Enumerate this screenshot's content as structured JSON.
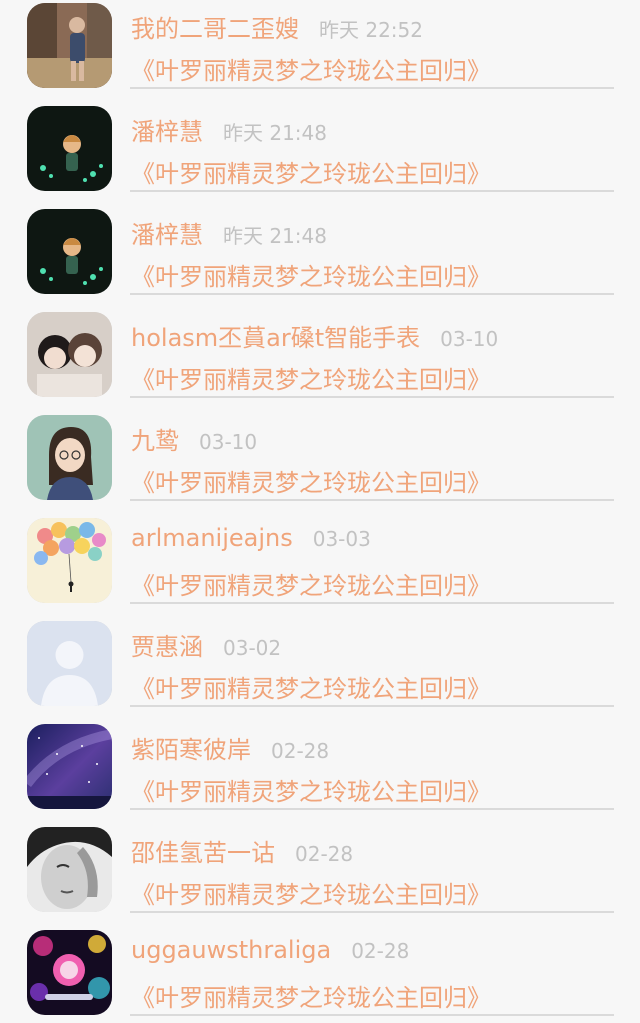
{
  "comments": [
    {
      "name": "我的二哥二歪嫂",
      "time": "昨天 22:52",
      "title": "《叶罗丽精灵梦之玲珑公主回归》",
      "avatar": "avatar-photo-girl-park"
    },
    {
      "name": "潘梓慧",
      "time": "昨天 21:48",
      "title": "《叶罗丽精灵梦之玲珑公主回归》",
      "avatar": "avatar-moon-boy"
    },
    {
      "name": "潘梓慧",
      "time": "昨天 21:48",
      "title": "《叶罗丽精灵梦之玲珑公主回归》",
      "avatar": "avatar-moon-boy"
    },
    {
      "name": "holasm丕蒷ar磉t智能手表",
      "time": "03-10",
      "title": "《叶罗丽精灵梦之玲珑公主回归》",
      "avatar": "avatar-two-girls"
    },
    {
      "name": "九鸷",
      "time": "03-10",
      "title": "《叶罗丽精灵梦之玲珑公主回归》",
      "avatar": "avatar-cartoon-girl"
    },
    {
      "name": "arlmanijeajns",
      "time": "03-03",
      "title": "《叶罗丽精灵梦之玲珑公主回归》",
      "avatar": "avatar-balloons"
    },
    {
      "name": "贾惠涵",
      "time": "03-02",
      "title": "《叶罗丽精灵梦之玲珑公主回归》",
      "avatar": "avatar-default-silhouette"
    },
    {
      "name": "紫陌寒彼岸",
      "time": "02-28",
      "title": "《叶罗丽精灵梦之玲珑公主回归》",
      "avatar": "avatar-starry-sky"
    },
    {
      "name": "邵佳氢苦一诂",
      "time": "02-28",
      "title": "《叶罗丽精灵梦之玲珑公主回归》",
      "avatar": "avatar-bw-face"
    },
    {
      "name": "uggauwsthraliga",
      "time": "02-28",
      "title": "《叶罗丽精灵梦之玲珑公主回归》",
      "avatar": "avatar-neon-party"
    }
  ],
  "colors": {
    "accent": "#f0a47a",
    "time": "#c2c2c2",
    "divider": "#dadada",
    "background": "#f7f7f7"
  }
}
